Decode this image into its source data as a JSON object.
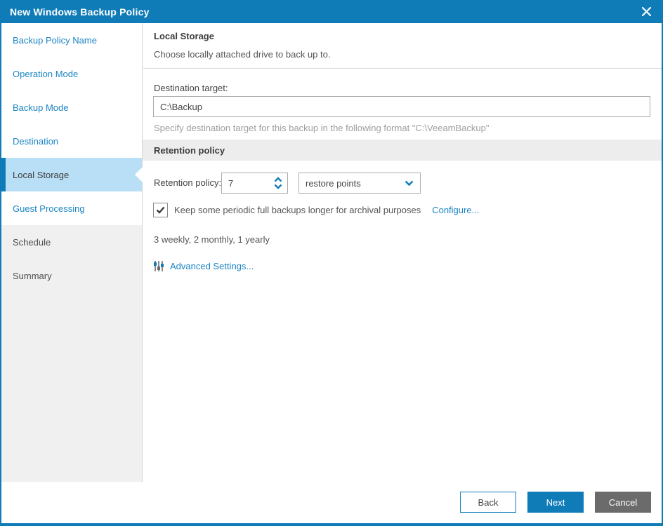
{
  "colors": {
    "accent": "#0f7cb8",
    "link": "#1b84c4",
    "selected-bg": "#b9dff6",
    "cancel-gray": "#6b6b6b"
  },
  "window": {
    "title": "New Windows Backup Policy"
  },
  "sidebar": {
    "items": [
      {
        "label": "Backup Policy Name",
        "state": "link"
      },
      {
        "label": "Operation Mode",
        "state": "link"
      },
      {
        "label": "Backup Mode",
        "state": "link"
      },
      {
        "label": "Destination",
        "state": "link"
      },
      {
        "label": "Local Storage",
        "state": "selected"
      },
      {
        "label": "Guest Processing",
        "state": "link"
      },
      {
        "label": "Schedule",
        "state": "disabled"
      },
      {
        "label": "Summary",
        "state": "disabled"
      }
    ]
  },
  "main": {
    "header": {
      "title": "Local Storage",
      "subtitle": "Choose locally attached drive to back up to."
    },
    "destination": {
      "label": "Destination target:",
      "value": "C:\\Backup",
      "hint": "Specify destination target for this backup in the following format \"C:\\VeeamBackup\""
    },
    "retention": {
      "section_title": "Retention policy",
      "label": "Retention policy:",
      "count": "7",
      "unit": "restore points",
      "keep_label": "Keep some periodic full backups longer for archival purposes",
      "keep_checked": true,
      "configure_link": "Configure...",
      "gfs_summary": "3 weekly, 2 monthly, 1 yearly",
      "advanced_link": "Advanced Settings..."
    }
  },
  "footer": {
    "back": "Back",
    "next": "Next",
    "cancel": "Cancel"
  }
}
